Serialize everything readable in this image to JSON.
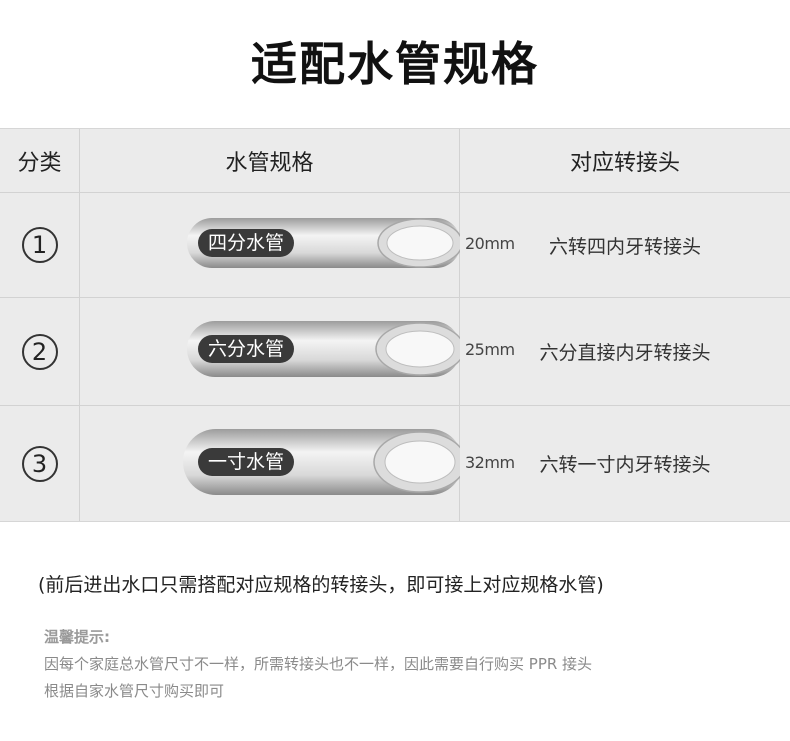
{
  "title": "适配水管规格",
  "table": {
    "headers": [
      "分类",
      "水管规格",
      "对应转接头"
    ],
    "rows": [
      {
        "index": "1",
        "pipe_label": "四分水管",
        "size": "20mm",
        "fitting": "六转四内牙转接头"
      },
      {
        "index": "2",
        "pipe_label": "六分水管",
        "size": "25mm",
        "fitting": "六分直接内牙转接头"
      },
      {
        "index": "3",
        "pipe_label": "一寸水管",
        "size": "32mm",
        "fitting": "六转一寸内牙转接头"
      }
    ]
  },
  "note": "(前后进出水口只需搭配对应规格的转接头，即可接上对应规格水管)",
  "tips": {
    "title": "温馨提示:",
    "line1": "因每个家庭总水管尺寸不一样，所需转接头也不一样，因此需要自行购买 PPR 接头",
    "line2": "根据自家水管尺寸购买即可"
  },
  "colors": {
    "table_bg": "#ebebeb",
    "label_bg": "#3a3a3a",
    "tips_text": "#8a8a8a"
  }
}
